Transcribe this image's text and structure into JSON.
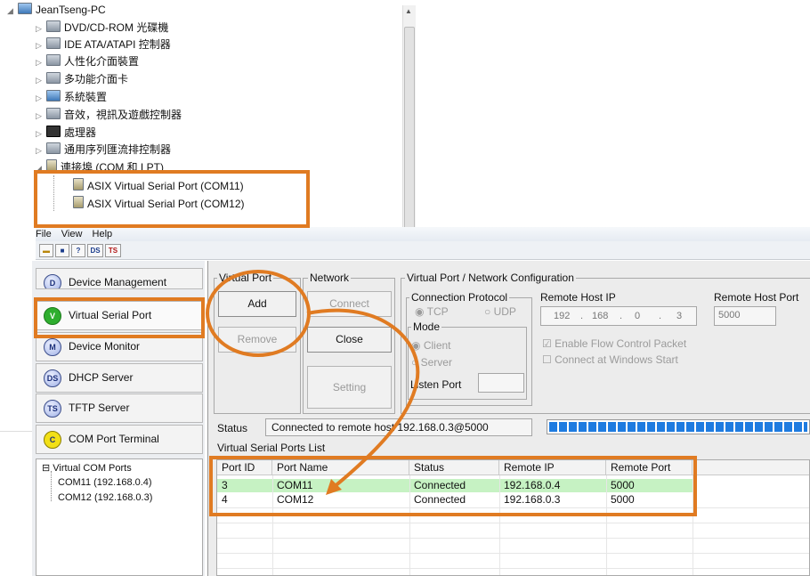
{
  "device_manager": {
    "root": "JeanTseng-PC",
    "categories": [
      "DVD/CD-ROM 光碟機",
      "IDE ATA/ATAPI 控制器",
      "人性化介面裝置",
      "多功能介面卡",
      "系統裝置",
      "音效，視訊及遊戲控制器",
      "處理器",
      "通用序列匯流排控制器"
    ],
    "ports_category": "連接埠 (COM 和 LPT)",
    "ports": [
      "ASIX Virtual Serial Port (COM11)",
      "ASIX Virtual Serial Port (COM12)"
    ]
  },
  "menu": {
    "file": "File",
    "view": "View",
    "help": "Help"
  },
  "toolbar": {
    "ds": "DS",
    "ts": "TS"
  },
  "nav": {
    "items": [
      {
        "badge": "D",
        "label": "Device Management"
      },
      {
        "badge": "V",
        "label": "Virtual Serial Port"
      },
      {
        "badge": "M",
        "label": "Device Monitor"
      },
      {
        "badge": "DS",
        "label": "DHCP Server"
      },
      {
        "badge": "TS",
        "label": "TFTP Server"
      },
      {
        "badge": "C",
        "label": "COM Port Terminal"
      }
    ],
    "active_color": "#2eae2e",
    "terminal_color": "#f2e017"
  },
  "vcom_tree": {
    "root": "Virtual COM Ports",
    "children": [
      "COM11 (192.168.0.4)",
      "COM12 (192.168.0.3)"
    ]
  },
  "virtual_port": {
    "title": "Virtual Port",
    "add": "Add",
    "remove": "Remove"
  },
  "network": {
    "title": "Network",
    "connect": "Connect",
    "close": "Close",
    "setting": "Setting"
  },
  "config": {
    "title": "Virtual Port / Network Configuration",
    "protocol_title": "Connection Protocol",
    "tcp": "TCP",
    "udp": "UDP",
    "mode_title": "Mode",
    "client": "Client",
    "server": "Server",
    "listen_port": "Listen Port",
    "remote_host_ip_label": "Remote Host IP",
    "ip": [
      "192",
      "168",
      "0",
      "3"
    ],
    "remote_host_port_label": "Remote Host Port",
    "remote_port": "5000",
    "enable_flow": "Enable Flow Control Packet",
    "connect_start": "Connect at Windows Start"
  },
  "status": {
    "label": "Status",
    "text": "Connected to remote host 192.168.0.3@5000",
    "progress": 1.0
  },
  "list": {
    "title": "Virtual Serial Ports List",
    "columns": [
      "Port ID",
      "Port Name",
      "Status",
      "Remote IP",
      "Remote Port"
    ],
    "rows": [
      [
        "3",
        "COM11",
        "Connected",
        "192.168.0.4",
        "5000"
      ],
      [
        "4",
        "COM12",
        "Connected",
        "192.168.0.3",
        "5000"
      ]
    ],
    "selected_row_color": "#c6f2c3"
  },
  "annotation_color": "#e07b22"
}
